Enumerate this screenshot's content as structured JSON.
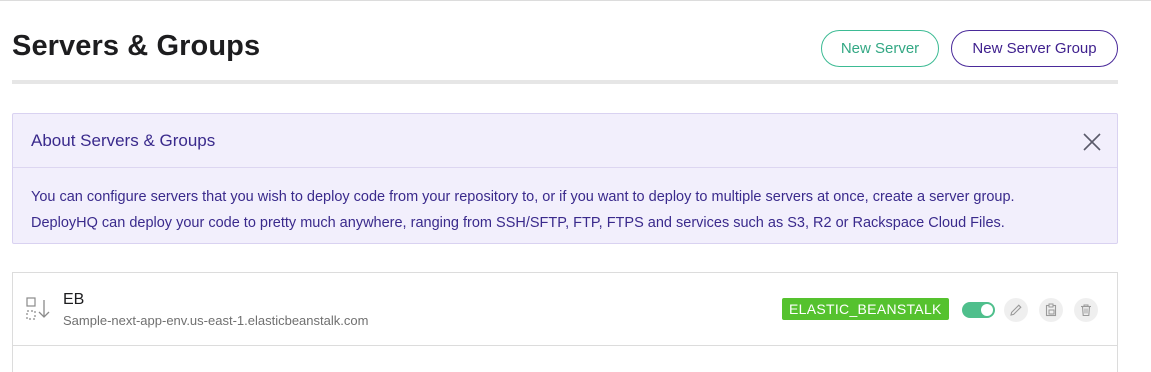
{
  "header": {
    "title": "Servers & Groups",
    "new_server_label": "New Server",
    "new_server_group_label": "New Server Group"
  },
  "info": {
    "title": "About Servers & Groups",
    "line1": "You can configure servers that you wish to deploy code from your repository to, or if you want to deploy to multiple servers at once, create a server group.",
    "line2": "DeployHQ can deploy your code to pretty much anywhere, ranging from SSH/SFTP, FTP, FTPS and services such as S3, R2 or Rackspace Cloud Files."
  },
  "servers": [
    {
      "name": "EB",
      "host": "Sample-next-app-env.us-east-1.elasticbeanstalk.com",
      "protocol_badge": "ELASTIC_BEANSTALK",
      "enabled": true
    }
  ],
  "colors": {
    "accent_green": "#3dbb94",
    "accent_purple": "#3e1f8d",
    "badge_green": "#55c22e",
    "info_bg": "#f2effc"
  },
  "icons": {
    "drag": "drag-handle-icon",
    "close": "close-icon",
    "edit": "pencil-icon",
    "copy": "clipboard-icon",
    "delete": "trash-icon"
  }
}
